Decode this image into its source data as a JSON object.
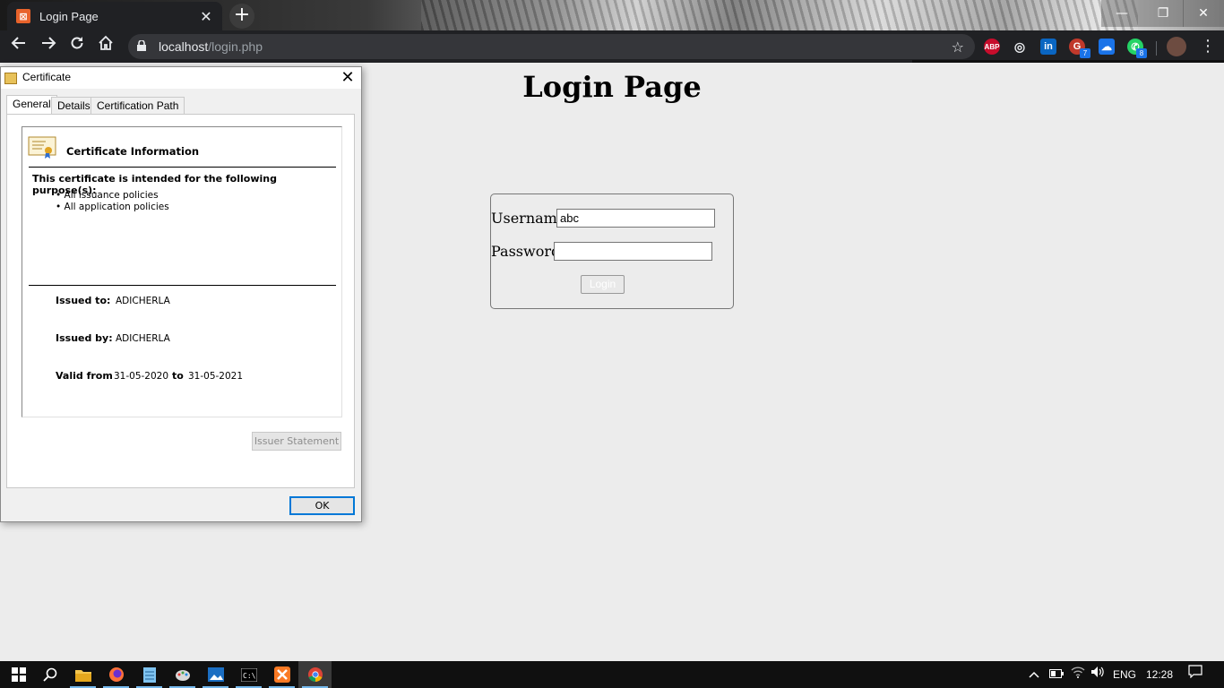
{
  "browser": {
    "tab_title": "Login Page",
    "tab_close": "✕",
    "new_tab": "+",
    "url_host": "localhost",
    "url_path": "/login.php",
    "window_controls": {
      "minimize": "—",
      "maximize": "❐",
      "close": "✕"
    },
    "extensions": [
      {
        "name": "adblock-plus-icon",
        "label": "ABP",
        "color": "#c70d2c"
      },
      {
        "name": "globe-icon",
        "label": "🌐",
        "color": "#202124"
      },
      {
        "name": "linkedin-icon",
        "label": "in",
        "color": "#0a66c2"
      },
      {
        "name": "grammarly-icon",
        "label": "G",
        "color": "#c0392b",
        "badge": "7"
      },
      {
        "name": "cloud-icon",
        "label": "☁",
        "color": "#1a73e8"
      },
      {
        "name": "whatsapp-icon",
        "label": "✆",
        "color": "#25d366",
        "badge": "8"
      }
    ]
  },
  "page": {
    "heading": "Login Page",
    "form": {
      "username_label": "Username:",
      "username_value": "abc",
      "password_label": "Password:",
      "password_value": "",
      "login_button": "Login"
    }
  },
  "certificate_dialog": {
    "title": "Certificate",
    "close": "✕",
    "tabs": [
      "General",
      "Details",
      "Certification Path"
    ],
    "active_tab": "General",
    "info_heading": "Certificate Information",
    "purpose_heading": "This certificate is intended for the following purpose(s):",
    "purposes": [
      "• All issuance policies",
      "• All application policies"
    ],
    "issued_to_label": "Issued to:",
    "issued_to": "ADICHERLA",
    "issued_by_label": "Issued by:",
    "issued_by": "ADICHERLA",
    "valid_from_label": "Valid from",
    "valid_from": "31-05-2020",
    "to_label": "to",
    "valid_to": "31-05-2021",
    "issuer_statement_button": "Issuer Statement",
    "ok_button": "OK"
  },
  "taskbar": {
    "items": [
      {
        "name": "start-icon"
      },
      {
        "name": "search-icon"
      },
      {
        "name": "file-explorer-icon"
      },
      {
        "name": "firefox-icon"
      },
      {
        "name": "notepad-icon"
      },
      {
        "name": "paint-icon"
      },
      {
        "name": "photos-icon"
      },
      {
        "name": "command-prompt-icon"
      },
      {
        "name": "xampp-icon"
      },
      {
        "name": "chrome-icon"
      }
    ],
    "language": "ENG",
    "time": "12:28"
  }
}
